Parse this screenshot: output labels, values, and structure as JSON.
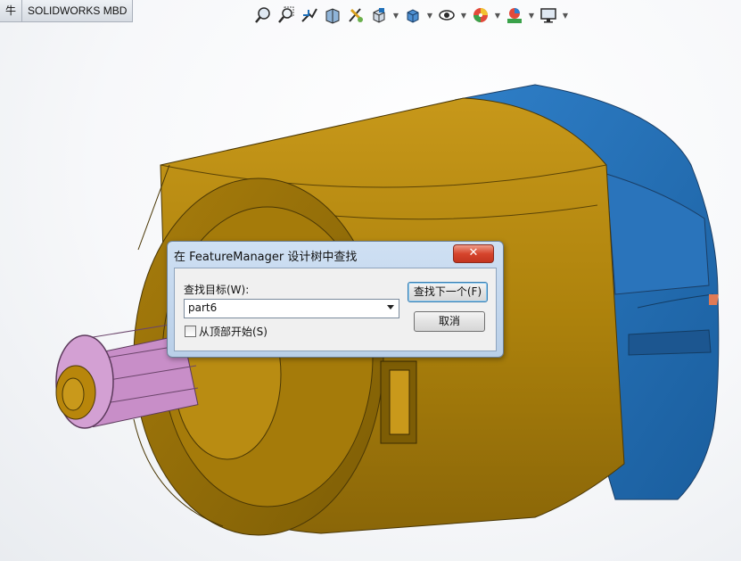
{
  "tabs": [
    {
      "label": "牛"
    },
    {
      "label": "SOLIDWORKS MBD"
    }
  ],
  "toolbar": {
    "icons": [
      "zoom-to-fit-icon",
      "zoom-to-area-icon",
      "previous-view-icon",
      "section-view-icon",
      "dynamic-annotation-icon",
      "view-orientation-icon",
      "display-style-icon",
      "hide-show-icon",
      "edit-appearance-icon",
      "apply-scene-icon",
      "view-settings-icon"
    ]
  },
  "dialog": {
    "title": "在 FeatureManager 设计树中查找",
    "close_label": "✕",
    "find_label": "查找目标(W):",
    "find_value": "part6",
    "from_top_label": "从顶部开始(S)",
    "from_top_checked": false,
    "find_next_button": "查找下一个(F)",
    "cancel_button": "取消"
  },
  "colors": {
    "housing": "#b8860b",
    "end_cap": "#1f6fb8",
    "gear": "#c88ec8"
  }
}
